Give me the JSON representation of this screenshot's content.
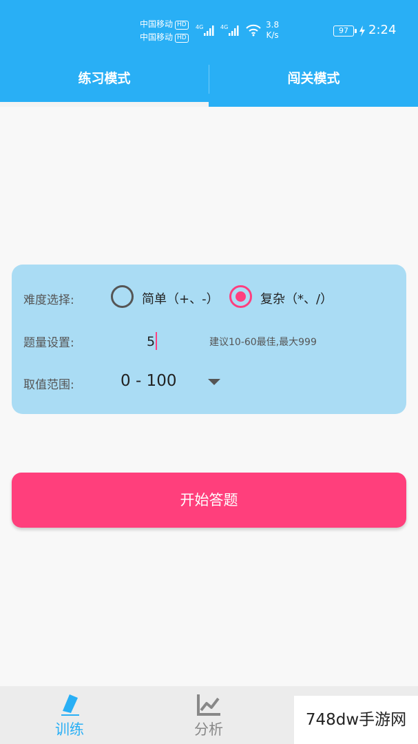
{
  "status_bar": {
    "carrier_1": "中国移动",
    "carrier_2": "中国移动",
    "hd_badge": "HD",
    "net_type_1": "4G",
    "net_type_2": "4G",
    "speed_value": "3.8",
    "speed_unit": "K/s",
    "battery": "97",
    "time": "2:24"
  },
  "tabs": [
    {
      "label": "练习模式",
      "selected": true
    },
    {
      "label": "闯关模式",
      "selected": false
    }
  ],
  "settings": {
    "difficulty_label": "难度选择:",
    "difficulty_options": [
      {
        "label": "简单（+、-）",
        "checked": false
      },
      {
        "label": "复杂（*、/）",
        "checked": true
      }
    ],
    "quantity_label": "题量设置:",
    "quantity_value": "5",
    "quantity_hint": "建议10-60最佳,最大999",
    "range_label": "取值范围:",
    "range_value": "0 - 100"
  },
  "start_button": "开始答题",
  "bottom_nav": [
    {
      "label": "训练",
      "icon": "pencil-icon",
      "active": true
    },
    {
      "label": "分析",
      "icon": "line-chart-icon",
      "active": false
    }
  ],
  "watermark": "748dw手游网",
  "colors": {
    "primary": "#29aff5",
    "accent": "#ff3f7c",
    "card": "#aadcf4"
  }
}
